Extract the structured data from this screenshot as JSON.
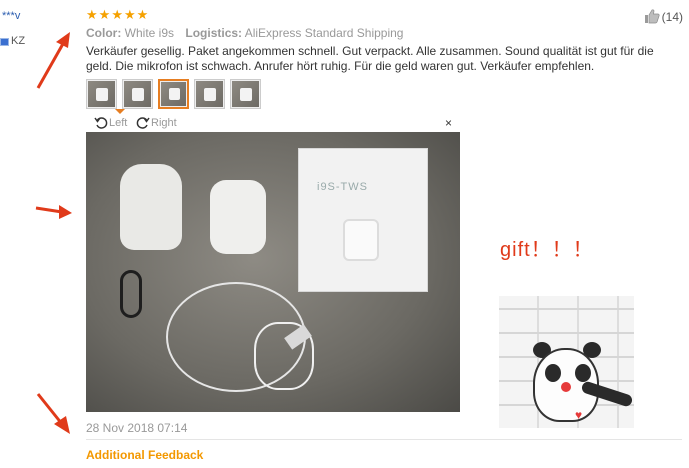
{
  "user": {
    "name": "***v",
    "country": "KZ"
  },
  "review": {
    "rating_stars": 5,
    "helpful_count": "(14)",
    "color_label": "Color:",
    "color_value": "White i9s",
    "logistics_label": "Logistics:",
    "logistics_value": "AliExpress Standard Shipping",
    "text": "Verkäufer gesellig. Paket angekommen schnell. Gut verpackt. Alle zusammen. Sound qualität ist gut für die geld. Die mikrofon ist schwach. Anrufer hört ruhig. Für die geld waren gut. Verkäufer empfehlen.",
    "date": "28 Nov 2018 07:14"
  },
  "viewer": {
    "rotate_left": "Left",
    "rotate_right": "Right",
    "close": "×",
    "product_label": "i9S-TWS"
  },
  "sticker_text": "gift！！！",
  "footer": {
    "additional_feedback": "Additional Feedback"
  },
  "colors": {
    "accent": "#f39800",
    "star": "#f5a100",
    "arrow": "#e03a1a",
    "link": "#2a5db0"
  },
  "icons": [
    "thumbs-up-icon",
    "rotate-left-icon",
    "rotate-right-icon",
    "close-icon",
    "star-icon",
    "arrow-icon"
  ]
}
